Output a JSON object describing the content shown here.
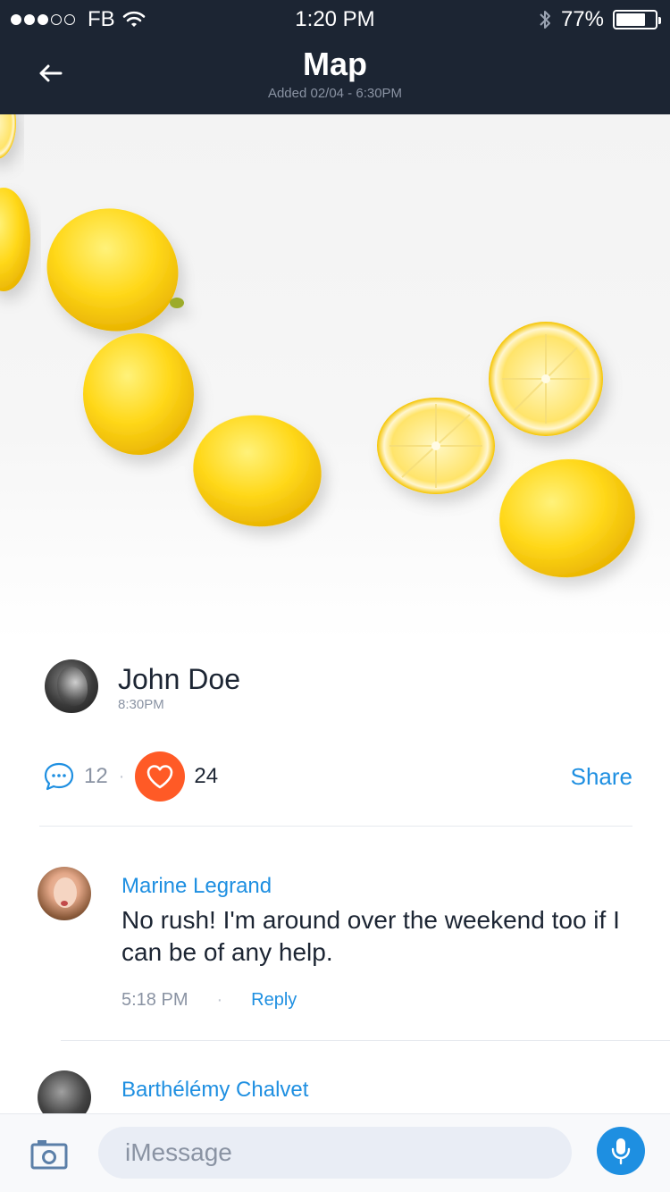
{
  "status_bar": {
    "carrier": "FB",
    "time": "1:20 PM",
    "battery": "77%",
    "battery_level": 0.77
  },
  "header": {
    "title": "Map",
    "subtitle": "Added 02/04 - 6:30PM",
    "back_icon": "arrow-left-icon"
  },
  "post": {
    "author_name": "John Doe",
    "author_time": "8:30PM",
    "comment_count": "12",
    "like_count": "24",
    "share_label": "Share"
  },
  "comments": [
    {
      "name": "Marine Legrand",
      "text": "No rush! I'm around over the weekend too if I can be of any help.",
      "time": "5:18 PM",
      "reply_label": "Reply"
    },
    {
      "name": "Barthélémy Chalvet"
    }
  ],
  "input_bar": {
    "placeholder": "iMessage",
    "camera_icon": "camera-icon",
    "mic_icon": "microphone-icon"
  },
  "colors": {
    "header_bg": "#1c2533",
    "accent_blue": "#1e8fe1",
    "like_orange": "#ff5a26"
  }
}
